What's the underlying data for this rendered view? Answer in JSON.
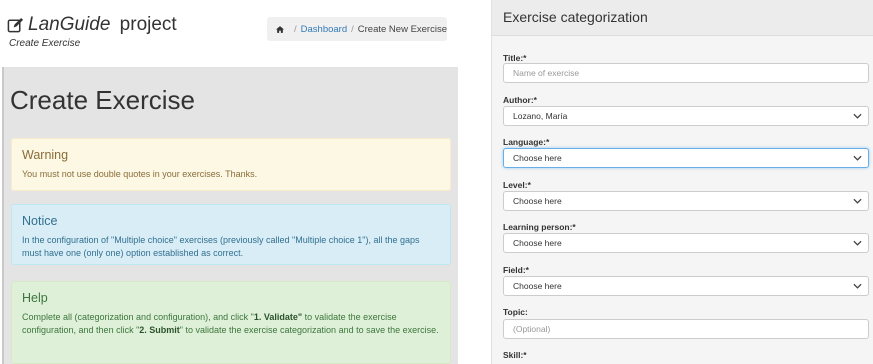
{
  "header": {
    "project_name": "LanGuide",
    "project_suffix": " project",
    "subtitle": "Create Exercise"
  },
  "breadcrumb": {
    "dashboard": "Dashboard",
    "current": "Create New Exercise",
    "separator": "/"
  },
  "main": {
    "title": "Create Exercise",
    "warning": {
      "heading": "Warning",
      "text": "You must not use double quotes in your exercises. Thanks."
    },
    "notice": {
      "heading": "Notice",
      "text": "In the configuration of \"Multiple choice\" exercises (previously called \"Multiple choice 1\"), all the gaps must have one (only one) option established as correct."
    },
    "help": {
      "heading": "Help",
      "text_1": "Complete all (categorization and configuration), and click \"",
      "validate": "1. Validate\"",
      "text_2": " to validate the exercise configuration, and then click \"",
      "submit": "2. Submit",
      "text_3": "\" to validate the exercise categorization and to save the exercise."
    }
  },
  "form": {
    "heading": "Exercise categorization",
    "fields": [
      {
        "label": "Title:*",
        "value": "Name of exercise",
        "kind": "placeholder"
      },
      {
        "label": "Author:*",
        "value": "Lozano, María",
        "kind": "select"
      },
      {
        "label": "Language:*",
        "value": "Choose here",
        "kind": "select"
      },
      {
        "label": "Level:*",
        "value": "Choose here",
        "kind": "select"
      },
      {
        "label": "Learning person:*",
        "value": "Choose here",
        "kind": "select"
      },
      {
        "label": "Field:*",
        "value": "Choose here",
        "kind": "select"
      },
      {
        "label": "Topic:",
        "value": "(Optional)",
        "kind": "placeholder"
      },
      {
        "label": "Skill:*"
      }
    ]
  },
  "colors": {
    "link": "#337ab7",
    "warning_bg": "#fcf8e3",
    "info_bg": "#d9edf7",
    "success_bg": "#dff0d8",
    "focus_border": "#66afe9"
  }
}
